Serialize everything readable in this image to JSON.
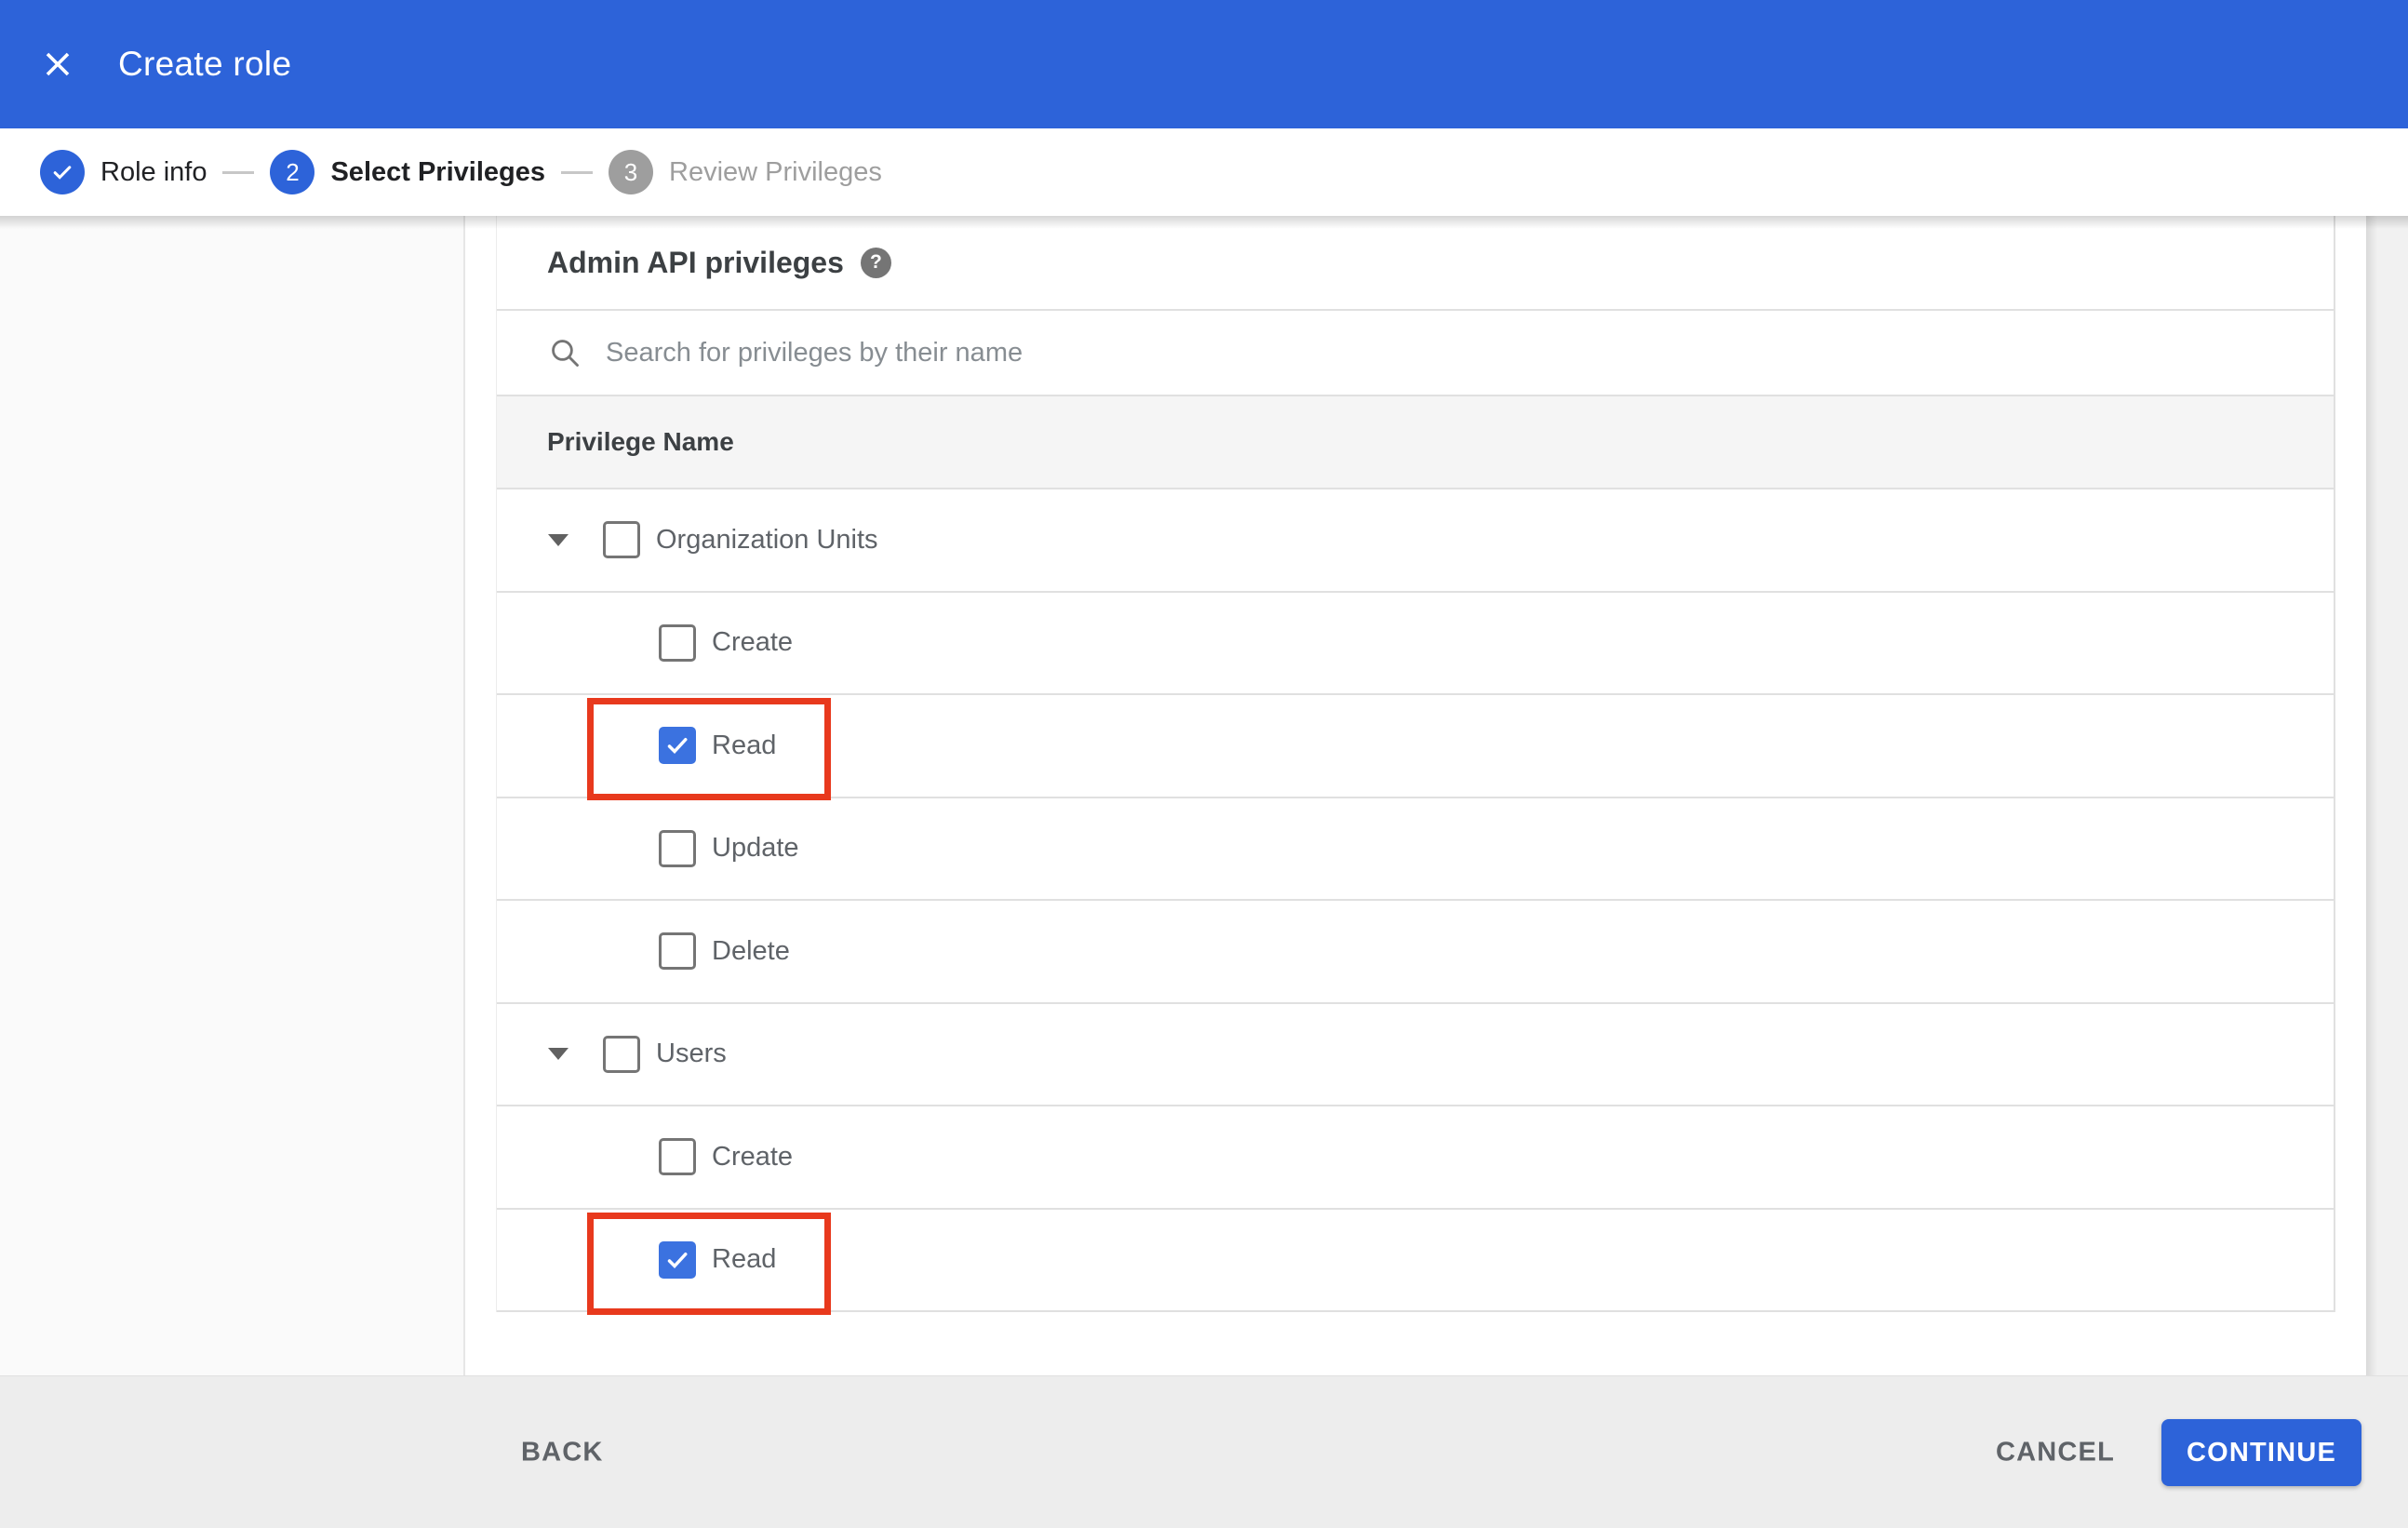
{
  "appbar": {
    "title": "Create role"
  },
  "stepper": {
    "steps": [
      {
        "label": "Role info",
        "state": "completed"
      },
      {
        "label": "Select Privileges",
        "state": "active",
        "number": "2"
      },
      {
        "label": "Review Privileges",
        "state": "upcoming",
        "number": "3"
      }
    ]
  },
  "content": {
    "section_title": "Admin API privileges",
    "help_icon": "question-mark",
    "search": {
      "placeholder": "Search for privileges by their name",
      "value": ""
    },
    "table": {
      "column_header": "Privilege Name",
      "groups": [
        {
          "label": "Organization Units",
          "checked": false,
          "expanded": true,
          "children": [
            {
              "label": "Create",
              "checked": false,
              "highlighted": false
            },
            {
              "label": "Read",
              "checked": true,
              "highlighted": true
            },
            {
              "label": "Update",
              "checked": false,
              "highlighted": false
            },
            {
              "label": "Delete",
              "checked": false,
              "highlighted": false
            }
          ]
        },
        {
          "label": "Users",
          "checked": false,
          "expanded": true,
          "children": [
            {
              "label": "Create",
              "checked": false,
              "highlighted": false
            },
            {
              "label": "Read",
              "checked": true,
              "highlighted": true
            }
          ]
        }
      ]
    }
  },
  "footer": {
    "back_label": "BACK",
    "cancel_label": "CANCEL",
    "continue_label": "CONTINUE"
  },
  "colors": {
    "primary": "#2d63d9",
    "checkbox": "#3b72e0",
    "highlight": "#e8391d",
    "footerbg": "#ededed",
    "inactive": "#9e9e9e"
  }
}
